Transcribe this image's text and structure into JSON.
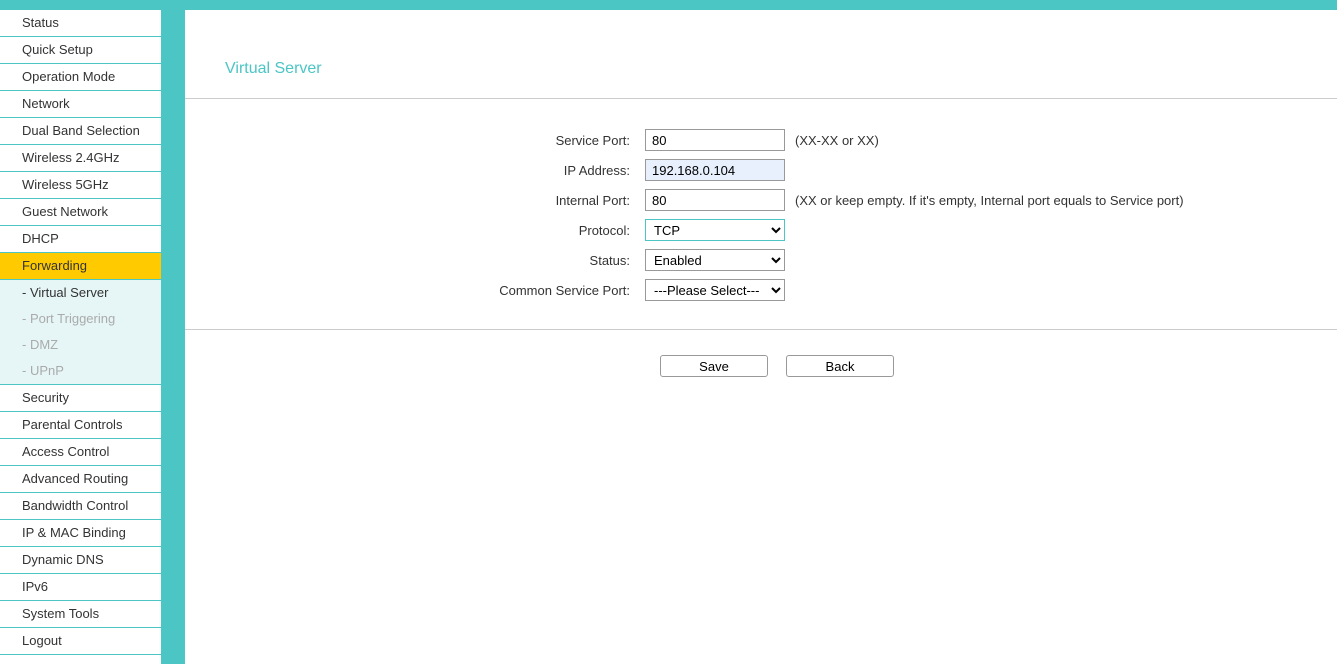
{
  "colors": {
    "accent": "#4cc5c5",
    "highlight": "#ffcb00"
  },
  "page": {
    "title": "Virtual Server"
  },
  "nav": {
    "items": [
      "Status",
      "Quick Setup",
      "Operation Mode",
      "Network",
      "Dual Band Selection",
      "Wireless 2.4GHz",
      "Wireless 5GHz",
      "Guest Network",
      "DHCP"
    ],
    "active": "Forwarding",
    "sub": [
      "- Virtual Server",
      "- Port Triggering",
      "- DMZ",
      "- UPnP"
    ],
    "items2": [
      "Security",
      "Parental Controls",
      "Access Control",
      "Advanced Routing",
      "Bandwidth Control",
      "IP & MAC Binding",
      "Dynamic DNS",
      "IPv6",
      "System Tools",
      "Logout"
    ]
  },
  "form": {
    "service_port": {
      "label": "Service Port:",
      "value": "80",
      "hint": "(XX-XX or XX)"
    },
    "ip_address": {
      "label": "IP Address:",
      "value": "192.168.0.104"
    },
    "internal_port": {
      "label": "Internal Port:",
      "value": "80",
      "hint": "(XX or keep empty. If it's empty, Internal port equals to Service port)"
    },
    "protocol": {
      "label": "Protocol:",
      "value": "TCP"
    },
    "status": {
      "label": "Status:",
      "value": "Enabled"
    },
    "common_service": {
      "label": "Common Service Port:",
      "value": "---Please Select---"
    }
  },
  "buttons": {
    "save": "Save",
    "back": "Back"
  }
}
